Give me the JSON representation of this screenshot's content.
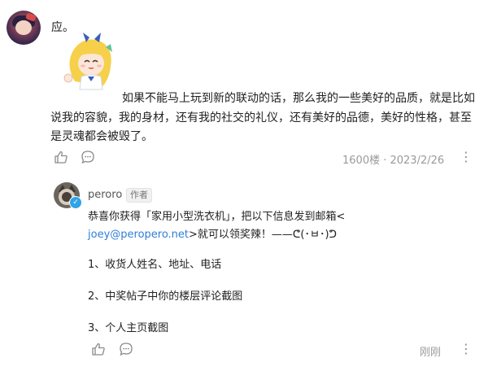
{
  "comment": {
    "reply_text": "应。",
    "body": "如果不能马上玩到新的联动的话，那么我的一些美好的品质，就是比如说我的容貌，我的身材，还有我的社交的礼仪，还有美好的品德，美好的性格，甚至是灵魂都会被毁了。",
    "floor_date": "1600楼 · 2023/2/26",
    "more_label": "⋮"
  },
  "sub_reply": {
    "username": "peroro",
    "badge": "作者",
    "line1": "恭喜你获得「家用小型洗衣机」，把以下信息发到邮箱<",
    "email": "joey@peropero.net",
    "line2_after": ">就可以领奖辣！——ᕦ(･ㅂ･)ᕤ",
    "items": [
      "1、收货人姓名、地址、电话",
      "2、中奖帖子中你的楼层评论截图",
      "3、个人主页截图"
    ],
    "time": "刚刚",
    "more_label": "⋮"
  },
  "colors": {
    "link": "#2e7ed8",
    "verified": "#2ea4e8",
    "meta": "#9a9a9a"
  },
  "icons": [
    "thumbs-up-icon",
    "comment-icon",
    "more-icon",
    "verified-icon"
  ]
}
